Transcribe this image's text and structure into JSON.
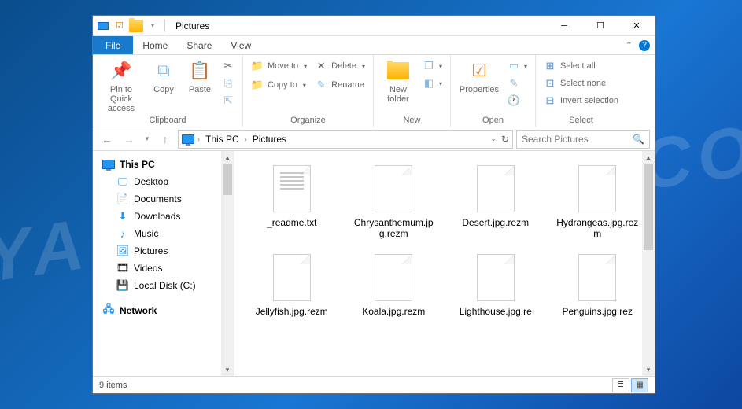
{
  "title": "Pictures",
  "tabs": {
    "file": "File",
    "home": "Home",
    "share": "Share",
    "view": "View"
  },
  "ribbon": {
    "clipboard": {
      "label": "Clipboard",
      "pin": "Pin to Quick access",
      "copy": "Copy",
      "paste": "Paste"
    },
    "organize": {
      "label": "Organize",
      "moveto": "Move to",
      "copyto": "Copy to",
      "delete": "Delete",
      "rename": "Rename"
    },
    "new": {
      "label": "New",
      "newfolder": "New folder"
    },
    "open": {
      "label": "Open",
      "properties": "Properties"
    },
    "select": {
      "label": "Select",
      "all": "Select all",
      "none": "Select none",
      "invert": "Invert selection"
    }
  },
  "address": {
    "thispc": "This PC",
    "folder": "Pictures"
  },
  "search": {
    "placeholder": "Search Pictures"
  },
  "nav": {
    "thispc": "This PC",
    "desktop": "Desktop",
    "documents": "Documents",
    "downloads": "Downloads",
    "music": "Music",
    "pictures": "Pictures",
    "videos": "Videos",
    "localdisk": "Local Disk (C:)",
    "network": "Network"
  },
  "files": [
    {
      "name": "_readme.txt",
      "type": "txt"
    },
    {
      "name": "Chrysanthemum.jpg.rezm",
      "type": "file"
    },
    {
      "name": "Desert.jpg.rezm",
      "type": "file"
    },
    {
      "name": "Hydrangeas.jpg.rezm",
      "type": "file"
    },
    {
      "name": "Jellyfish.jpg.rezm",
      "type": "file"
    },
    {
      "name": "Koala.jpg.rezm",
      "type": "file"
    },
    {
      "name": "Lighthouse.jpg.re",
      "type": "file"
    },
    {
      "name": "Penguins.jpg.rez",
      "type": "file"
    }
  ],
  "status": {
    "count": "9 items"
  },
  "watermark": "MYANTISPYWARE.COM"
}
